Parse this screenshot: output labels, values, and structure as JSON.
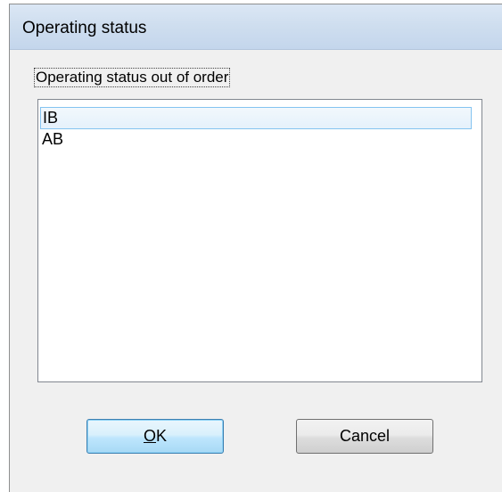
{
  "window": {
    "title": "Operating status"
  },
  "list": {
    "label": "Operating status out of order",
    "items": [
      {
        "label": "IB",
        "selected": true
      },
      {
        "label": "AB",
        "selected": false
      }
    ]
  },
  "buttons": {
    "ok": {
      "accel": "O",
      "rest": "K"
    },
    "cancel": {
      "label": "Cancel"
    }
  }
}
